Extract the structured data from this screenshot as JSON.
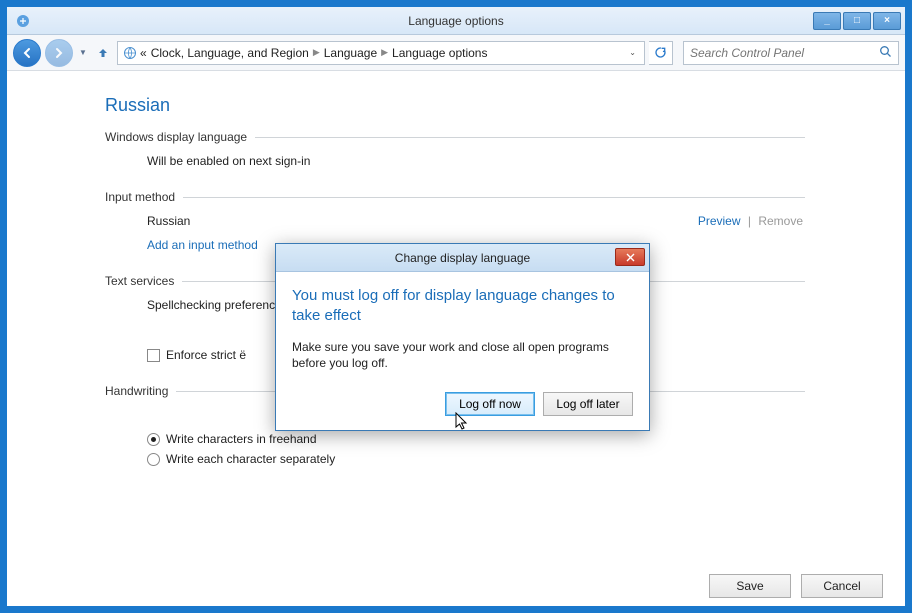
{
  "window": {
    "title": "Language options",
    "controls": {
      "min": "_",
      "max": "□",
      "close": "×"
    }
  },
  "nav": {
    "breadcrumb": {
      "prefix": "«",
      "seg1": "Clock, Language, and Region",
      "seg2": "Language",
      "seg3": "Language options"
    },
    "search_placeholder": "Search Control Panel"
  },
  "page": {
    "title": "Russian",
    "display_lang_section": "Windows display language",
    "display_lang_status": "Will be enabled on next sign-in",
    "input_section": "Input method",
    "input_lang": "Russian",
    "add_input": "Add an input method",
    "preview": "Preview",
    "remove": "Remove",
    "text_section": "Text services",
    "spellcheck": "Spellchecking preferenc",
    "strict_e": "Enforce strict ë",
    "handwriting_section": "Handwriting",
    "radio_freehand": "Write characters in freehand",
    "radio_separate": "Write each character separately"
  },
  "footer": {
    "save": "Save",
    "cancel": "Cancel"
  },
  "dialog": {
    "title": "Change display language",
    "heading": "You must log off for display language changes to take effect",
    "body": "Make sure you save your work and close all open programs before you log off.",
    "logoff_now": "Log off now",
    "logoff_later": "Log off later"
  }
}
